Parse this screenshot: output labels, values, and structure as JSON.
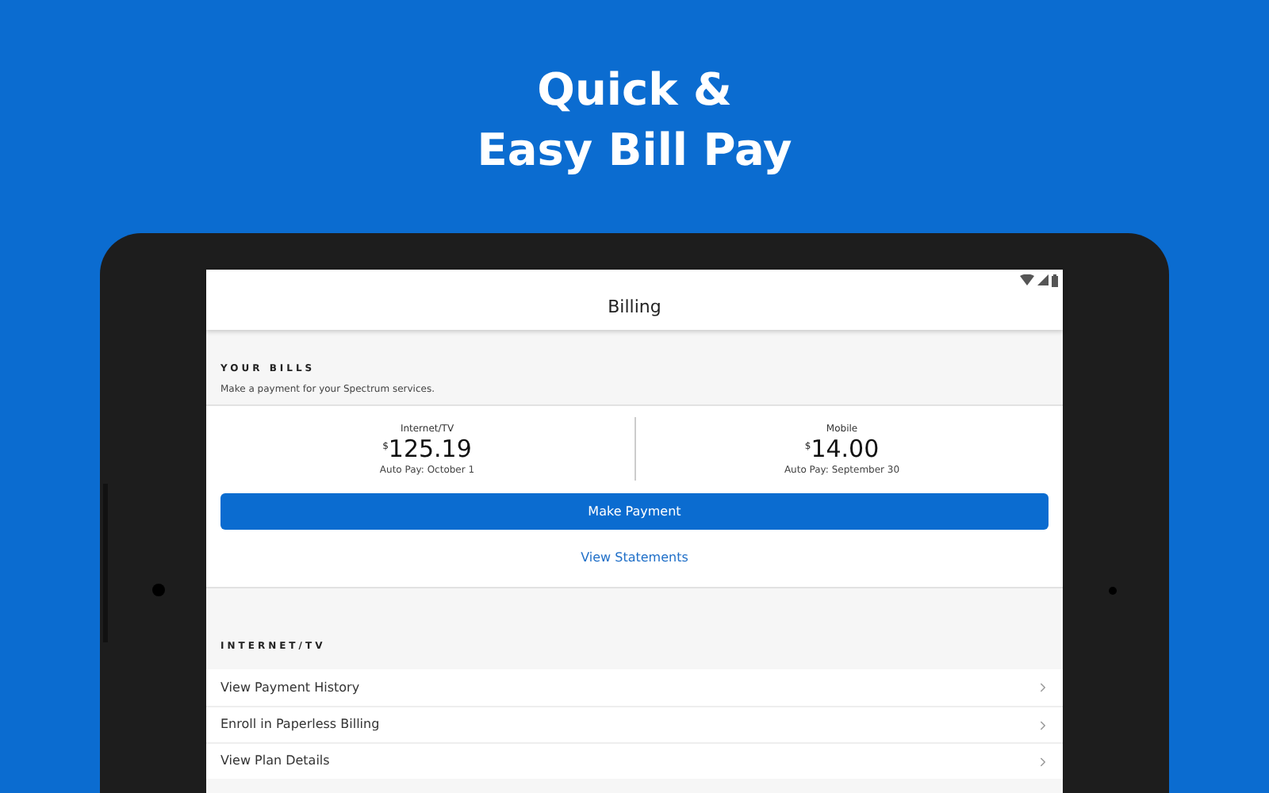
{
  "headline": [
    "Quick &",
    "Easy Bill Pay"
  ],
  "header": {
    "title": "Billing"
  },
  "your_bills": {
    "heading": "YOUR BILLS",
    "subtitle": "Make a payment for your Spectrum services.",
    "bills": [
      {
        "label": "Internet/TV",
        "currency": "$",
        "amount": "125.19",
        "note": "Auto Pay: October 1"
      },
      {
        "label": "Mobile",
        "currency": "$",
        "amount": "14.00",
        "note": "Auto Pay: September 30"
      }
    ],
    "primary_button": "Make Payment",
    "link": "View Statements"
  },
  "internet_tv": {
    "heading": "INTERNET/TV",
    "items": [
      "View Payment History",
      "Enroll in Paperless Billing",
      "View Plan Details"
    ]
  }
}
